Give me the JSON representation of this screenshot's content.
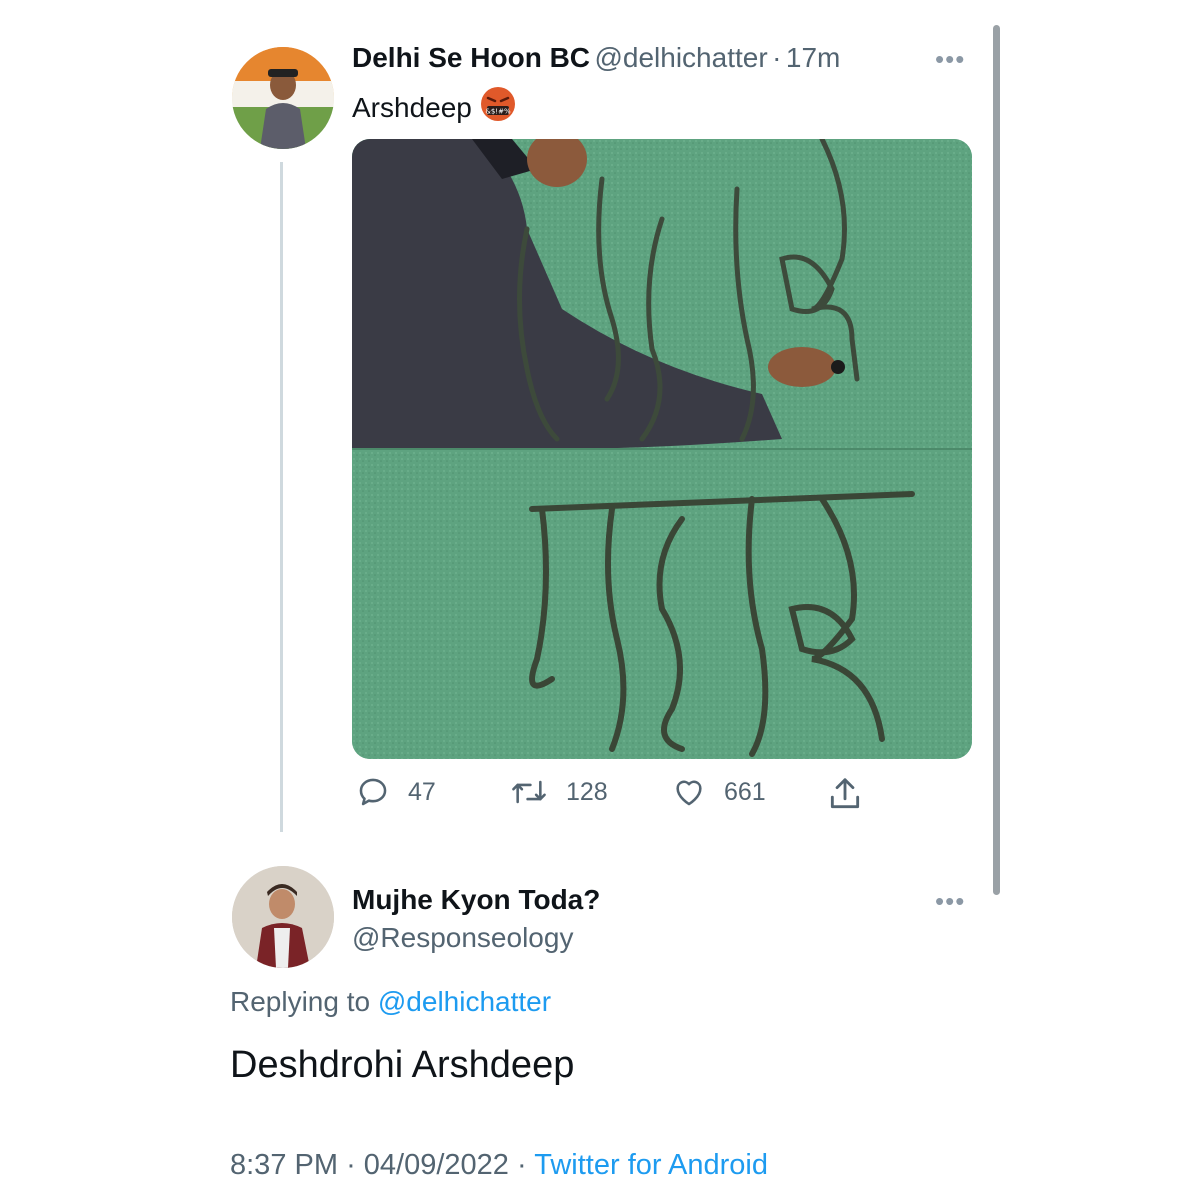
{
  "tweet": {
    "display_name": "Delhi Se Hoon BC",
    "handle": "@delhichatter",
    "separator": "·",
    "time": "17m",
    "text": "Arshdeep",
    "emoji_icon": "angry-face-symbols-icon",
    "media_alt": "Man writing Devanagari text on a green wall (two frames)",
    "actions": {
      "reply_count": "47",
      "retweet_count": "128",
      "like_count": "661"
    }
  },
  "reply": {
    "display_name": "Mujhe Kyon Toda?",
    "handle": "@Responseology",
    "replying_prefix": "Replying to",
    "replying_to": "@delhichatter",
    "text": "Deshdrohi Arshdeep",
    "time": "8:37 PM",
    "date": "04/09/2022",
    "separator": "·",
    "source": "Twitter for Android"
  },
  "colors": {
    "link": "#1d9bf0",
    "secondary_text": "#536471",
    "thread_line": "#cfd9de",
    "wall": "#5aa07e"
  }
}
